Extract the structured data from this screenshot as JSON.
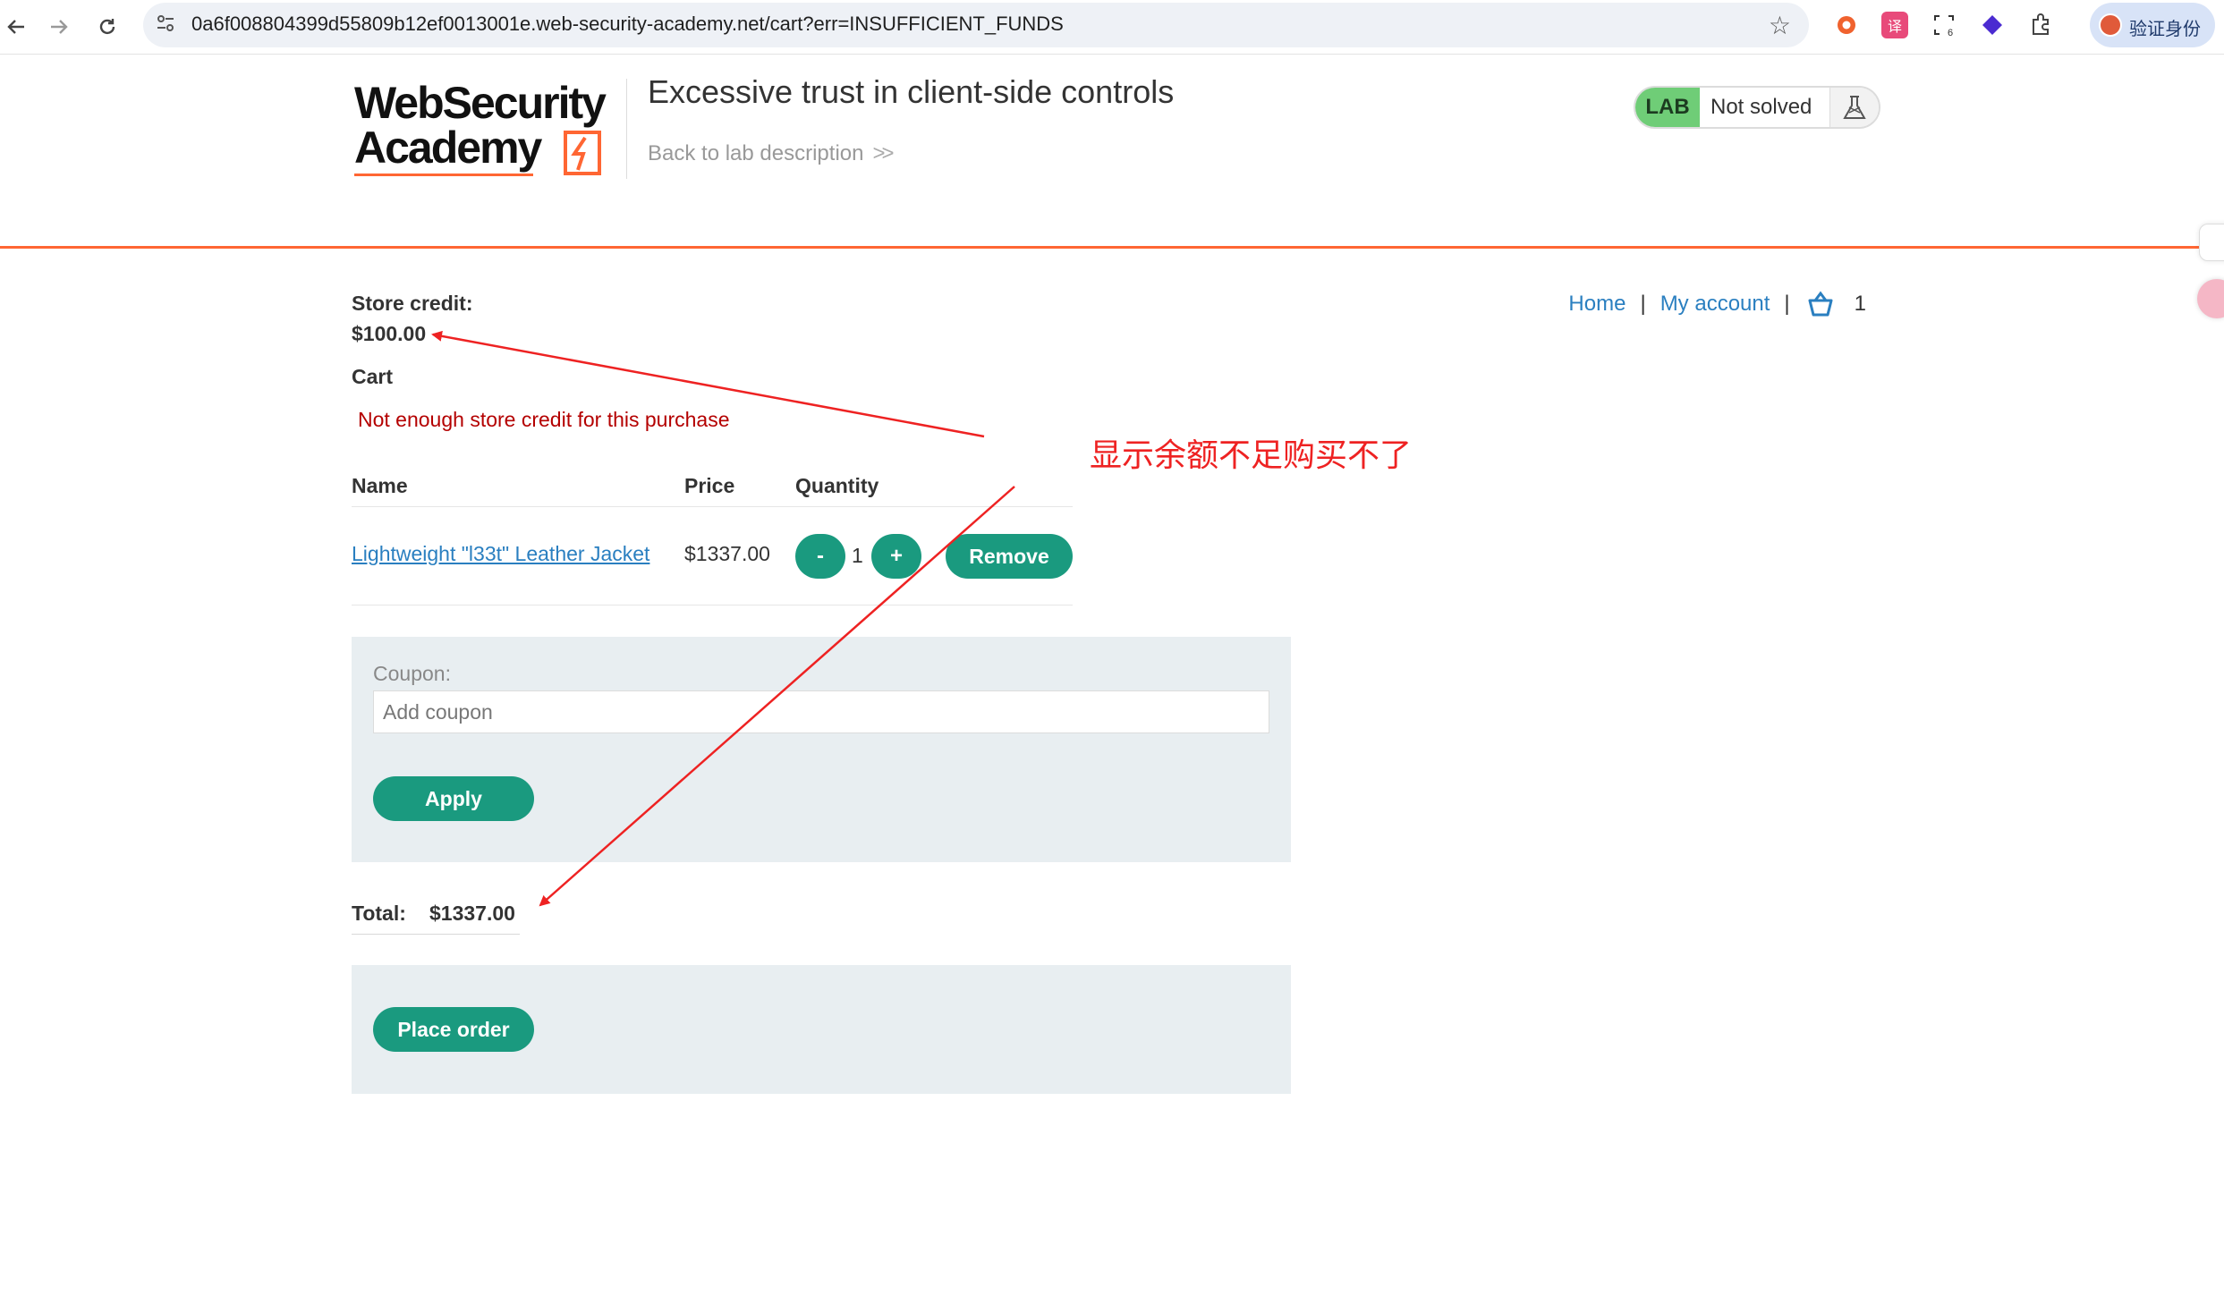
{
  "browser": {
    "url": "0a6f008804399d55809b12ef0013001e.web-security-academy.net/cart?err=INSUFFICIENT_FUNDS",
    "back_icon": "arrow-left-icon",
    "forward_icon": "arrow-right-icon",
    "reload_icon": "reload-icon",
    "profile_label": "验证身份"
  },
  "header": {
    "logo_line1": "WebSecurity",
    "logo_line2": "Academy",
    "lab_title": "Excessive trust in client-side controls",
    "back_link": "Back to lab description",
    "badge_lab": "LAB",
    "badge_status": "Not solved",
    "accent_color": "#ff6633"
  },
  "nav": {
    "home": "Home",
    "separator": "|",
    "my_account": "My account",
    "cart_count": "1"
  },
  "store": {
    "credit_label": "Store credit:",
    "credit_value": "$100.00",
    "cart_heading": "Cart",
    "error": "Not enough store credit for this purchase"
  },
  "cart_table": {
    "columns": [
      "Name",
      "Price",
      "Quantity"
    ],
    "rows": [
      {
        "name": "Lightweight \"l33t\" Leather Jacket",
        "price": "$1337.00",
        "qty_minus": "-",
        "qty": "1",
        "qty_plus": "+",
        "remove": "Remove"
      }
    ]
  },
  "coupon": {
    "label": "Coupon:",
    "placeholder": "Add coupon",
    "apply": "Apply"
  },
  "total": {
    "label": "Total:",
    "value": "$1337.00"
  },
  "order": {
    "place_order": "Place order"
  },
  "annotation": {
    "text": "显示余额不足购买不了",
    "color": "#ee2222"
  },
  "button_color": "#1a9a7f",
  "link_color": "#2a7fc0"
}
